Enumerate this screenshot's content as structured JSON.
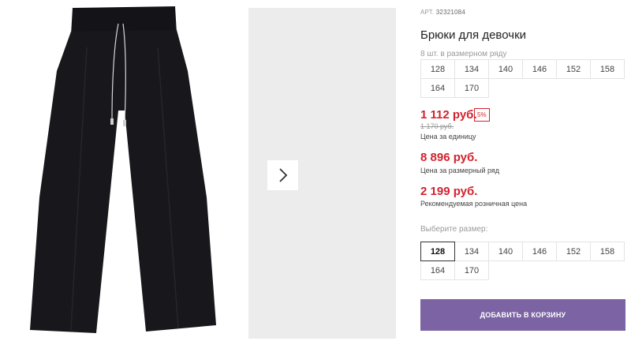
{
  "product": {
    "sku_label": "АРТ.",
    "sku": "32321084",
    "title": "Брюки для девочки"
  },
  "size_row": {
    "hint": "8 шт. в размерном ряду",
    "sizes": [
      "128",
      "134",
      "140",
      "146",
      "152",
      "158",
      "164",
      "170"
    ]
  },
  "pricing": {
    "unit_price": "1 112 руб.",
    "discount": "5%",
    "old_price": "1 170 руб.",
    "unit_label": "Цена за единицу",
    "row_price": "8 896 руб.",
    "row_label": "Цена за размерный ряд",
    "retail_price": "2 199 руб.",
    "retail_label": "Рекомендуемая розничная цена"
  },
  "size_select": {
    "hint": "Выберите размер:",
    "sizes": [
      "128",
      "134",
      "140",
      "146",
      "152",
      "158",
      "164",
      "170"
    ],
    "selected": "128"
  },
  "cart": {
    "add_label": "ДОБАВИТЬ В КОРЗИНУ"
  },
  "colors": {
    "price": "#d2222d",
    "button": "#7b63a4",
    "image_bg": "#ececec"
  },
  "icons": {
    "next": "chevron-right-icon"
  }
}
